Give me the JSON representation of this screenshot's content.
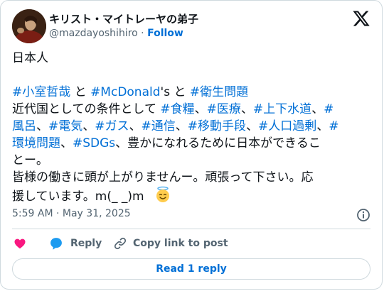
{
  "author": {
    "display_name": "キリスト・マイトレーヤの弟子",
    "handle": "@mazdayoshihiro",
    "separator": "·",
    "follow_label": "Follow"
  },
  "tweet": {
    "lines": [
      [
        {
          "t": "日本人"
        }
      ],
      [],
      [
        {
          "t": "#小室哲哉",
          "tag": true
        },
        {
          "t": " と "
        },
        {
          "t": "#McDonald",
          "tag": true
        },
        {
          "t": "'s と "
        },
        {
          "t": "#衛生問題",
          "tag": true
        }
      ],
      [
        {
          "t": "近代国としての条件として "
        },
        {
          "t": "#食糧",
          "tag": true
        },
        {
          "t": "、"
        },
        {
          "t": "#医療",
          "tag": true
        },
        {
          "t": "、"
        },
        {
          "t": "#上下水道",
          "tag": true
        },
        {
          "t": "、"
        },
        {
          "t": "#",
          "tag": true
        }
      ],
      [
        {
          "t": "風呂",
          "tag": true
        },
        {
          "t": "、"
        },
        {
          "t": "#電気",
          "tag": true
        },
        {
          "t": "、"
        },
        {
          "t": "#ガス",
          "tag": true
        },
        {
          "t": "、"
        },
        {
          "t": "#通信",
          "tag": true
        },
        {
          "t": "、"
        },
        {
          "t": "#移動手段",
          "tag": true
        },
        {
          "t": "、"
        },
        {
          "t": "#人口過剰",
          "tag": true
        },
        {
          "t": "、"
        },
        {
          "t": "#",
          "tag": true
        }
      ],
      [
        {
          "t": "環境問題",
          "tag": true
        },
        {
          "t": "、"
        },
        {
          "t": "#SDGs",
          "tag": true
        },
        {
          "t": "、豊かになれるために日本ができるこ"
        }
      ],
      [
        {
          "t": "とー。"
        }
      ],
      [
        {
          "t": "皆様の働きに頭が上がりませんー。頑張って下さい。応"
        }
      ],
      [
        {
          "t": "援しています。m(_ _)m"
        },
        {
          "emoji": "smiling-face-with-halo"
        }
      ]
    ]
  },
  "timestamp": "5:59 AM · May 31, 2025",
  "actions": {
    "like_icon": "heart-icon",
    "reply_label": "Reply",
    "copy_link_label": "Copy link to post"
  },
  "read_replies_label": "Read 1 reply",
  "colors": {
    "link": "#006fd6",
    "like": "#f91880",
    "reply": "#1d9bf0",
    "text": "#0f1419",
    "muted": "#536471",
    "border": "#cfd9de"
  }
}
